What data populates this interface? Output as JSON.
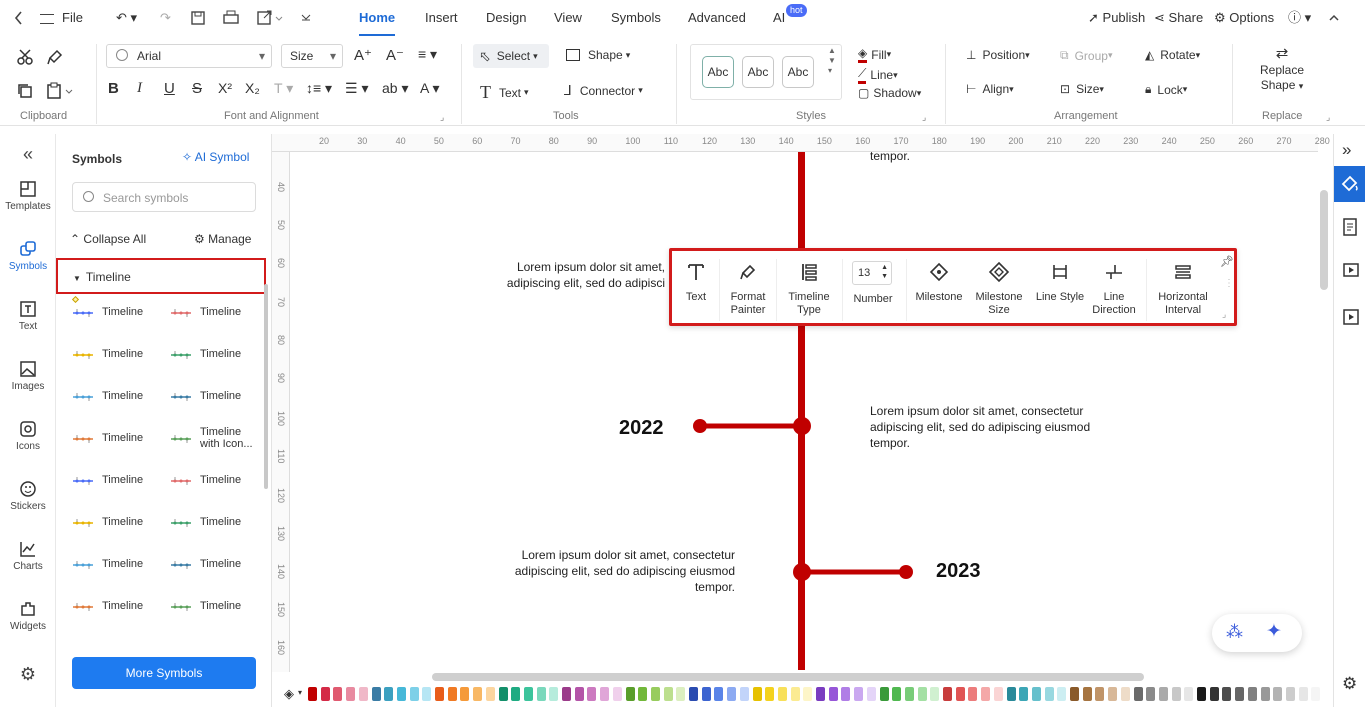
{
  "menu": {
    "file": "File",
    "tabs": [
      "Home",
      "Insert",
      "Design",
      "View",
      "Symbols",
      "Advanced",
      "AI"
    ],
    "hot": "hot",
    "publish": "Publish",
    "share": "Share",
    "options": "Options"
  },
  "ribbon": {
    "font": "Arial",
    "size": "Size",
    "groups": [
      "Clipboard",
      "Font and Alignment",
      "Tools",
      "Styles",
      "Arrangement",
      "Replace"
    ],
    "select": "Select",
    "shape": "Shape",
    "text": "Text",
    "connector": "Connector",
    "abc": [
      "Abc",
      "Abc",
      "Abc"
    ],
    "fill": "Fill",
    "line": "Line",
    "shadow": "Shadow",
    "position": "Position",
    "group": "Group",
    "rotate": "Rotate",
    "align": "Align",
    "lock": "Lock",
    "replace1": "Replace",
    "replace2": "Shape"
  },
  "rail": [
    "Templates",
    "Symbols",
    "Text",
    "Images",
    "Icons",
    "Stickers",
    "Charts",
    "Widgets"
  ],
  "symbols": {
    "title": "Symbols",
    "ai": "AI Symbol",
    "search_placeholder": "Search symbols",
    "collapse": "Collapse All",
    "manage": "Manage",
    "section": "Timeline",
    "items": [
      "Timeline",
      "Timeline",
      "Timeline",
      "Timeline",
      "Timeline",
      "Timeline",
      "Timeline",
      "Timeline with Icon...",
      "Timeline",
      "Timeline",
      "Timeline",
      "Timeline",
      "Timeline",
      "Timeline",
      "Timeline",
      "Timeline"
    ],
    "more": "More Symbols"
  },
  "ruler_top": [
    "20",
    "30",
    "40",
    "50",
    "60",
    "70",
    "80",
    "90",
    "100",
    "110",
    "120",
    "130",
    "140",
    "150",
    "160",
    "170",
    "180",
    "190",
    "200",
    "210",
    "220",
    "230",
    "240",
    "250",
    "260",
    "270",
    "280"
  ],
  "ruler_left": [
    "40",
    "50",
    "60",
    "70",
    "80",
    "90",
    "100",
    "110",
    "120",
    "130",
    "140",
    "150",
    "160"
  ],
  "canvas": {
    "top_text": "tempor.",
    "left_text1": "Lorem ipsum dolor sit amet, adipiscing elit, sed do adipisci",
    "right_text": "Lorem ipsum dolor sit amet, consectetur adipiscing elit, sed do adipiscing eiusmod tempor.",
    "left_text2": "Lorem ipsum dolor sit amet, consectetur adipiscing elit, sed do adipiscing eiusmod tempor.",
    "year1": "2022",
    "year2": "2023",
    "accent": "#c00000"
  },
  "float_toolbar": {
    "text": "Text",
    "format": "Format\nPainter",
    "type": "Timeline\nType",
    "num": "13",
    "number": "Number",
    "milestone": "Milestone",
    "msize": "Milestone\nSize",
    "lstyle": "Line Style",
    "ldir": "Line\nDirection",
    "hint": "Horizontal\nInterval"
  },
  "colors": [
    "#c00000",
    "#d42a47",
    "#e05a70",
    "#e88aa0",
    "#f0b8c8",
    "#3a7ca5",
    "#3ca0c0",
    "#46b8d8",
    "#7dd0e8",
    "#b6e6f4",
    "#e85d1a",
    "#f07a24",
    "#f59a3a",
    "#f8b865",
    "#fcd6a0",
    "#138f6a",
    "#1fab82",
    "#3cc49c",
    "#7ad8bc",
    "#b6ecdc",
    "#9b3b8a",
    "#b454a8",
    "#cc7ac0",
    "#e0a6d8",
    "#f0d0ec",
    "#5a9e2b",
    "#72b83a",
    "#98cc5e",
    "#bcdf8e",
    "#dcefc0",
    "#2a4bb0",
    "#3c64d0",
    "#5a84e8",
    "#8caaf2",
    "#c2d4fa",
    "#e6c100",
    "#f4d21e",
    "#f8e05a",
    "#fbeb92",
    "#fdf5c8",
    "#7a3cc0",
    "#9656d8",
    "#b07ee6",
    "#caa8f0",
    "#e4d4f8",
    "#3a9a3a",
    "#50b850",
    "#78cc78",
    "#a4e0a4",
    "#d0f0d0",
    "#c83c3c",
    "#e05454",
    "#ec7c7c",
    "#f4a8a8",
    "#fad4d4",
    "#2a8a9a",
    "#3ca6b6",
    "#66c0cc",
    "#98d8e0",
    "#cceef2",
    "#8a5a2a",
    "#a67440",
    "#c09468",
    "#d8b898",
    "#eedcc8",
    "#6a6a6a",
    "#8a8a8a",
    "#aaaaaa",
    "#c8c8c8",
    "#e6e6e6",
    "#1a1a1a",
    "#333333",
    "#4d4d4d",
    "#666666",
    "#808080",
    "#999999",
    "#b3b3b3",
    "#cccccc",
    "#e6e6e6",
    "#f5f5f5"
  ]
}
